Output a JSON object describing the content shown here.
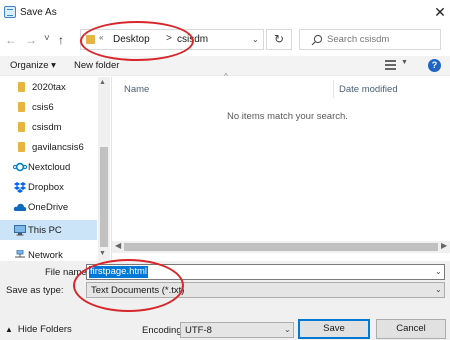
{
  "window": {
    "title": "Save As",
    "close_glyph": "✕",
    "app_icon": "save-dialog-icon"
  },
  "address_bar": {
    "overflow_glyph": "«",
    "breadcrumbs": [
      "Desktop",
      "csisdm"
    ],
    "separator": ">",
    "dropdown_glyph": "⌄",
    "refresh_glyph": "↻"
  },
  "nav_buttons": {
    "back": "←",
    "forward": "→",
    "recent": "˅",
    "up": "↑"
  },
  "search": {
    "placeholder": "Search csisdm",
    "value": ""
  },
  "toolbar": {
    "organize": "Organize ▾",
    "new_folder": "New folder",
    "help": "?"
  },
  "nav_pane": {
    "items": [
      {
        "label": "2020tax",
        "icon": "folder-icon"
      },
      {
        "label": "csis6",
        "icon": "folder-icon"
      },
      {
        "label": "csisdm",
        "icon": "folder-icon"
      },
      {
        "label": "gavilancsis6",
        "icon": "folder-icon"
      },
      {
        "label": "Nextcloud",
        "icon": "nextcloud-icon"
      },
      {
        "label": "Dropbox",
        "icon": "dropbox-icon"
      },
      {
        "label": "OneDrive",
        "icon": "onedrive-icon"
      },
      {
        "label": "This PC",
        "icon": "pc-icon",
        "selected": true
      },
      {
        "label": "Network",
        "icon": "network-icon"
      }
    ]
  },
  "content": {
    "columns": [
      "Name",
      "Date modified"
    ],
    "empty_message": "No items match your search."
  },
  "form": {
    "file_name_label": "File name:",
    "file_name_value": "firstpage.html",
    "save_type_label": "Save as type:",
    "save_type_value": "Text Documents (*.txt)",
    "encoding_label": "Encoding:",
    "encoding_value": "UTF-8"
  },
  "footer": {
    "hide_folders": "Hide Folders",
    "save": "Save",
    "cancel": "Cancel"
  },
  "colors": {
    "annotation": "#d8262a",
    "selection": "#0078d7",
    "selected_nav": "#cce4f7",
    "folder": "#e7b53f"
  }
}
